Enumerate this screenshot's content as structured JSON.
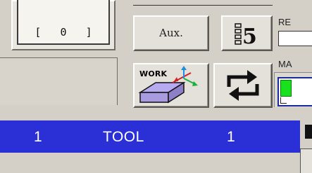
{
  "counter": {
    "display": "[   0   ]"
  },
  "buttons": {
    "aux_label": "Aux.",
    "work_label": "WORK",
    "menu5_icon": "menu-5-icon",
    "work_icon": "work-coordinate-icon",
    "cycle_icon": "swap-arrows-icon"
  },
  "right_panel": {
    "re_label": "RE",
    "ma_label": "MA"
  },
  "status_bar": {
    "num1": "1",
    "mode": "TOOL",
    "num2": "1"
  },
  "colors": {
    "background": "#d4d0c8",
    "status_bar": "#2b2fd6",
    "indicator_green": "#18e21b",
    "work_box": "#a89be0"
  }
}
